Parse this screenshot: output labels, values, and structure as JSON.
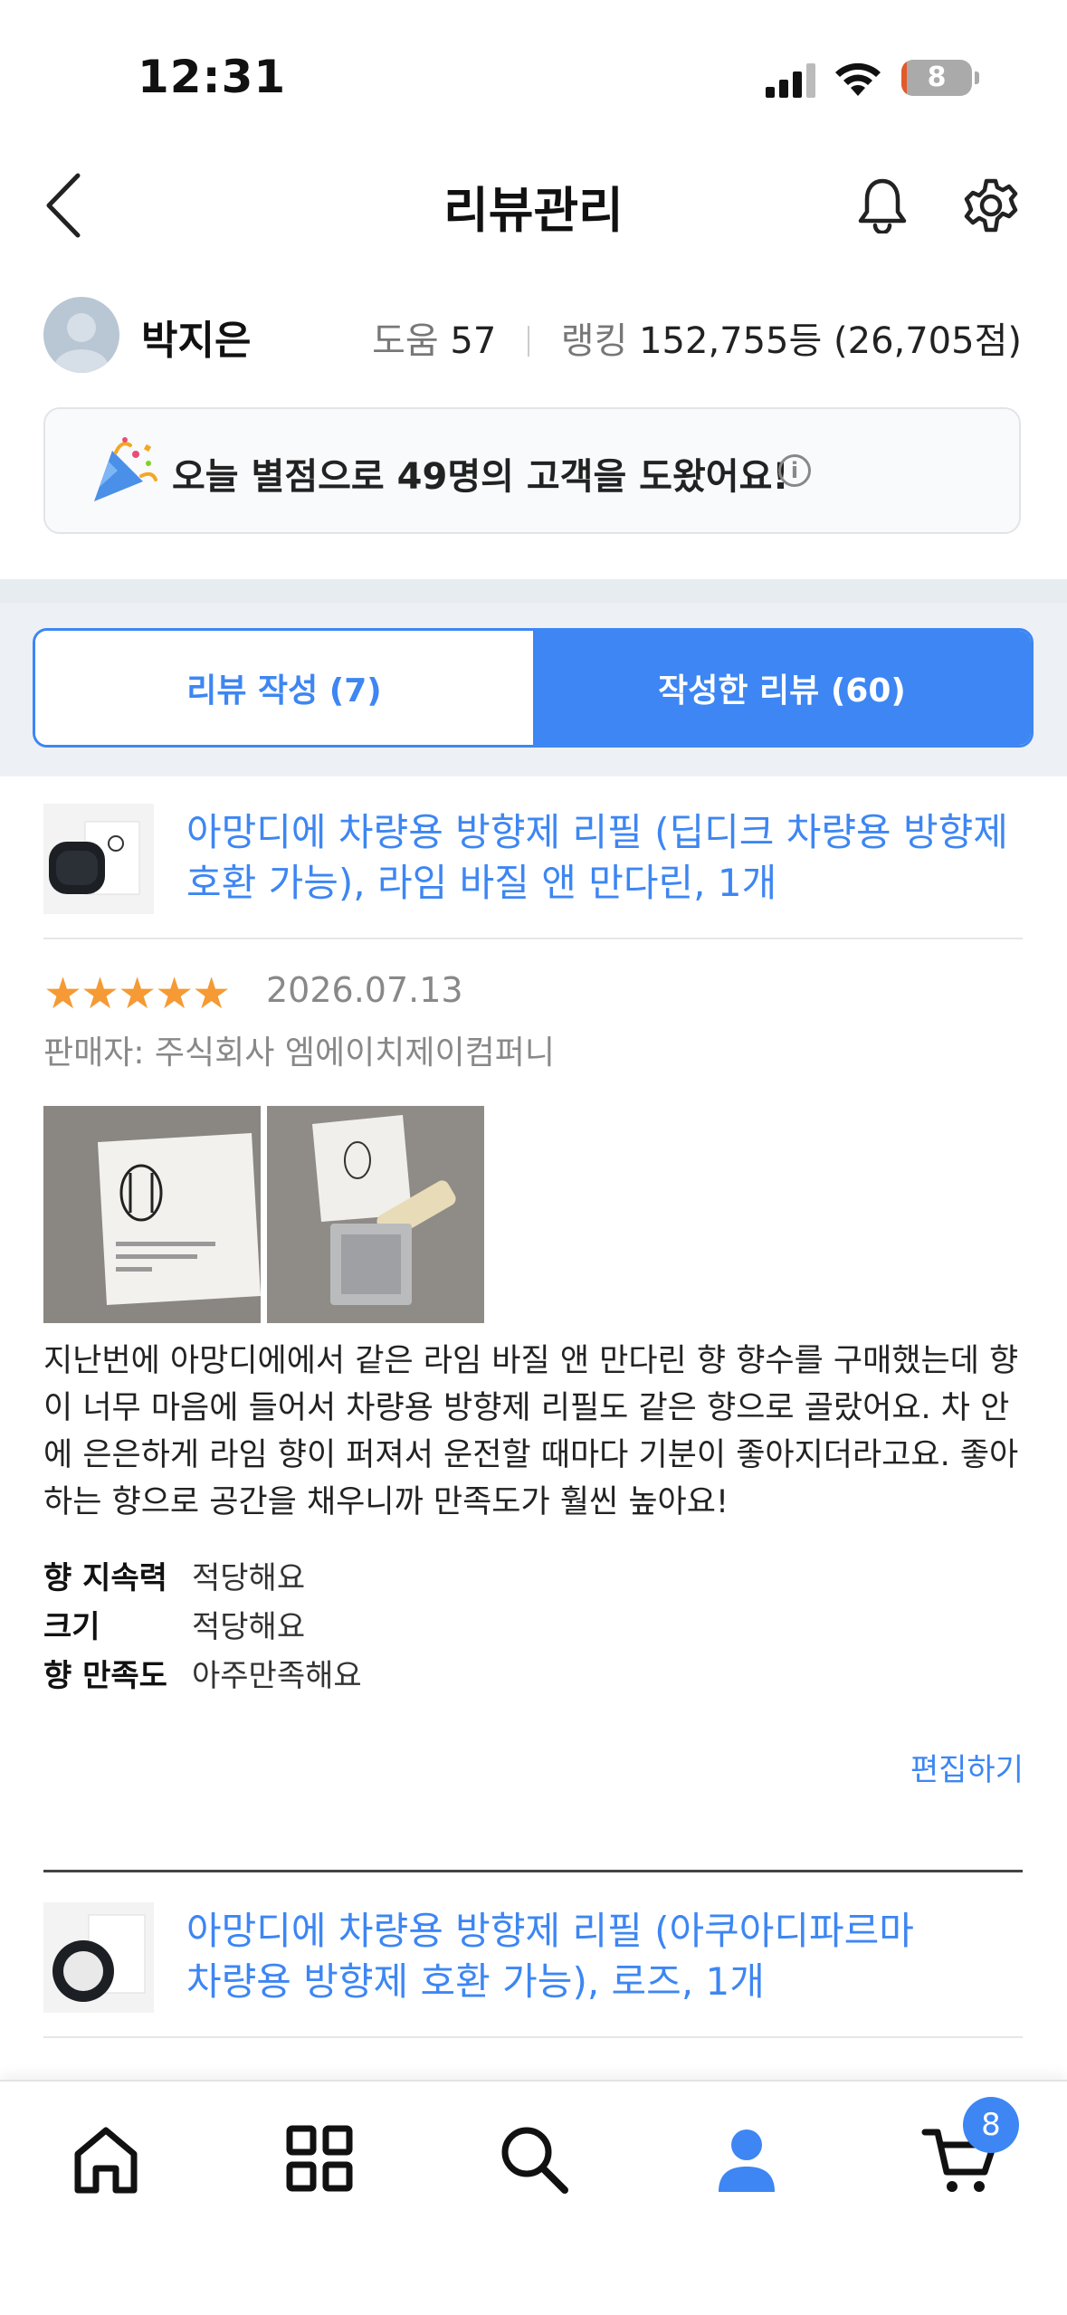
{
  "status_bar": {
    "time": "12:31",
    "battery": "8"
  },
  "header": {
    "title": "리뷰관리"
  },
  "profile": {
    "name": "박지은",
    "help_label": "도움",
    "help_value": "57",
    "rank_label": "랭킹",
    "rank_value": "152,755등 (26,705점)"
  },
  "notice": {
    "text": "오늘 별점으로 49명의 고객을 도왔어요!"
  },
  "tabs": [
    {
      "label": "리뷰 작성 (7)",
      "active": false
    },
    {
      "label": "작성한 리뷰 (60)",
      "active": true
    }
  ],
  "reviews": [
    {
      "product": "아망디에 차량용 방향제 리필 (딥디크 차량용 방향제 호환 가능), 라임 바질 앤 만다린, 1개",
      "rating": 5,
      "stars": "★★★★★",
      "date": "2026.07.13",
      "seller": "판매자: 주식회사 엠에이치제이컴퍼니",
      "body": "지난번에 아망디에에서 같은 라임 바질 앤 만다린 향 향수를 구매했는데 향이 너무 마음에 들어서 차량용 방향제 리필도 같은 향으로 골랐어요. 차 안에 은은하게 라임 향이 퍼져서 운전할 때마다 기분이 좋아지더라고요. 좋아하는 향으로 공간을 채우니까 만족도가 훨씬 높아요!",
      "attributes": [
        {
          "key": "향 지속력",
          "value": "적당해요"
        },
        {
          "key": "크기",
          "value": "적당해요"
        },
        {
          "key": "향 만족도",
          "value": "아주만족해요"
        }
      ],
      "edit_label": "편집하기"
    },
    {
      "product": "아망디에 차량용 방향제 리필 (아쿠아디파르마 차량용 방향제 호환 가능), 로즈, 1개"
    }
  ],
  "bottom_nav": {
    "items": [
      "home-icon",
      "category-grid-icon",
      "search-icon",
      "my-page-icon",
      "cart-icon"
    ],
    "cart_badge": "8"
  },
  "colors": {
    "accent": "#3d86f3",
    "star": "#f59a34"
  }
}
